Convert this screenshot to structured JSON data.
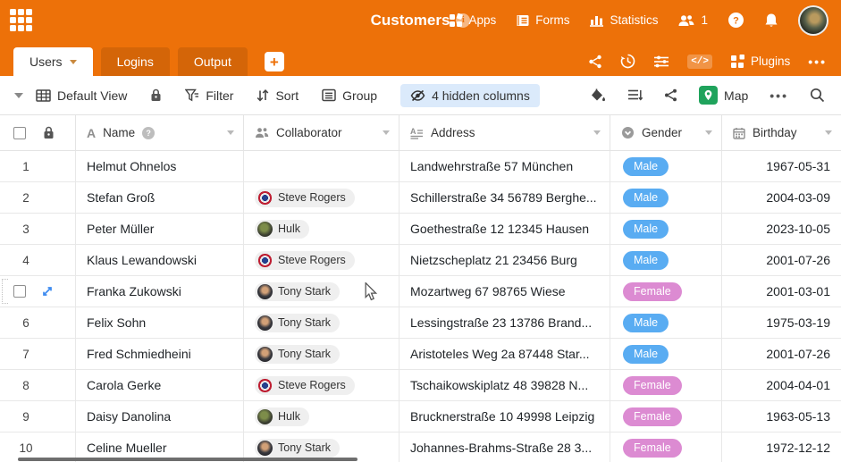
{
  "colors": {
    "brand_orange": "#ED7109",
    "tab_inactive_overlay": "rgba(0,0,0,0.10)",
    "male_pill": "#59ACF2",
    "female_pill": "#DC8BD2",
    "hidden_pill_bg": "#DBEAFB",
    "map_green": "#1FA35C",
    "expand_blue": "#3C8AF0",
    "chip_bg": "#EFEFEF"
  },
  "icons": {
    "topbar_left": "apps-grid-3x3",
    "title_right": "info-circle",
    "nav": [
      "apps-tiles",
      "form-document",
      "statistics-bars",
      "collaborators-people",
      "help-circle",
      "notification-bell",
      "user-avatar"
    ],
    "tabbar_right": [
      "share",
      "history-clock",
      "settings-sliders",
      "code-brackets",
      "plugins-grid",
      "more-dots"
    ],
    "toolbar": [
      "chevron-down",
      "table-grid",
      "lock",
      "filter-funnel",
      "sort-arrows",
      "group-box",
      "eye-slash",
      "fill-bucket",
      "row-height-lines",
      "share-nodes",
      "map-pin",
      "more-dots",
      "search-magnifier"
    ],
    "column_types": {
      "Name": "text-A",
      "Collaborator": "people",
      "Address": "long-text",
      "Gender": "single-select-circle",
      "Birthday": "calendar"
    }
  },
  "topbar": {
    "title": "Customers",
    "nav": [
      {
        "label": "Apps"
      },
      {
        "label": "Forms"
      },
      {
        "label": "Statistics"
      }
    ],
    "user_count": "1"
  },
  "tabs": {
    "items": [
      {
        "label": "Users",
        "active": true
      },
      {
        "label": "Logins",
        "active": false
      },
      {
        "label": "Output",
        "active": false
      }
    ],
    "plugins_label": "Plugins"
  },
  "toolbar": {
    "view_label": "Default View",
    "filter_label": "Filter",
    "sort_label": "Sort",
    "group_label": "Group",
    "hidden_columns_label": "4 hidden columns",
    "map_label": "Map"
  },
  "table": {
    "columns": [
      {
        "label": "Name",
        "type": "text"
      },
      {
        "label": "Collaborator",
        "type": "collaborator"
      },
      {
        "label": "Address",
        "type": "long-text"
      },
      {
        "label": "Gender",
        "type": "single-select"
      },
      {
        "label": "Birthday",
        "type": "date"
      }
    ],
    "rows": [
      {
        "num": "1",
        "name": "Helmut Ohnelos",
        "collaborator": null,
        "address": "Landwehrstraße 57 München",
        "gender": "Male",
        "birthday": "1967-05-31",
        "hovered": false
      },
      {
        "num": "2",
        "name": "Stefan Groß",
        "collaborator": {
          "name": "Steve Rogers",
          "avatar": "steve"
        },
        "address": "Schillerstraße 34 56789 Berghe...",
        "gender": "Male",
        "birthday": "2004-03-09",
        "hovered": false
      },
      {
        "num": "3",
        "name": "Peter Müller",
        "collaborator": {
          "name": "Hulk",
          "avatar": "hulk"
        },
        "address": "Goethestraße 12 12345 Hausen",
        "gender": "Male",
        "birthday": "2023-10-05",
        "hovered": false
      },
      {
        "num": "4",
        "name": "Klaus Lewandowski",
        "collaborator": {
          "name": "Steve Rogers",
          "avatar": "steve"
        },
        "address": "Nietzscheplatz 21 23456 Burg",
        "gender": "Male",
        "birthday": "2001-07-26",
        "hovered": false
      },
      {
        "num": "5",
        "name": "Franka Zukowski",
        "collaborator": {
          "name": "Tony Stark",
          "avatar": "tony"
        },
        "address": "Mozartweg 67 98765 Wiese",
        "gender": "Female",
        "birthday": "2001-03-01",
        "hovered": true
      },
      {
        "num": "6",
        "name": "Felix Sohn",
        "collaborator": {
          "name": "Tony Stark",
          "avatar": "tony"
        },
        "address": "Lessingstraße 23 13786 Brand...",
        "gender": "Male",
        "birthday": "1975-03-19",
        "hovered": false
      },
      {
        "num": "7",
        "name": "Fred Schmiedheini",
        "collaborator": {
          "name": "Tony Stark",
          "avatar": "tony"
        },
        "address": "Aristoteles Weg 2a 87448 Star...",
        "gender": "Male",
        "birthday": "2001-07-26",
        "hovered": false
      },
      {
        "num": "8",
        "name": "Carola Gerke",
        "collaborator": {
          "name": "Steve Rogers",
          "avatar": "steve"
        },
        "address": "Tschaikowskiplatz 48 39828 N...",
        "gender": "Female",
        "birthday": "2004-04-01",
        "hovered": false
      },
      {
        "num": "9",
        "name": "Daisy Danolina",
        "collaborator": {
          "name": "Hulk",
          "avatar": "hulk"
        },
        "address": "Brucknerstraße 10 49998 Leipzig",
        "gender": "Female",
        "birthday": "1963-05-13",
        "hovered": false
      },
      {
        "num": "10",
        "name": "Celine Mueller",
        "collaborator": {
          "name": "Tony Stark",
          "avatar": "tony"
        },
        "address": "Johannes-Brahms-Straße 28 3...",
        "gender": "Female",
        "birthday": "1972-12-12",
        "hovered": false
      }
    ]
  }
}
